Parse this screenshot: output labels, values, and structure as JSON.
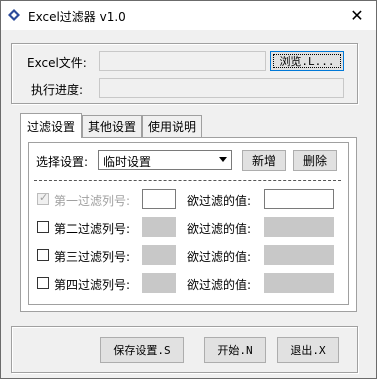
{
  "window": {
    "title": "Excel过滤器 v1.0",
    "close_glyph": "✕"
  },
  "file_section": {
    "excel_file_label": "Excel文件:",
    "excel_file_value": "",
    "browse_label": "浏览.L...",
    "progress_label": "执行进度:",
    "progress_value": ""
  },
  "tabs": [
    {
      "label": "过滤设置",
      "active": true
    },
    {
      "label": "其他设置",
      "active": false
    },
    {
      "label": "使用说明",
      "active": false
    }
  ],
  "filter_settings": {
    "select_label": "选择设置:",
    "select_value": "临时设置",
    "add_label": "新增",
    "delete_label": "删除",
    "rows": [
      {
        "checked": true,
        "enabled": false,
        "column_label": "第一过滤列号:",
        "column_value": "",
        "value_label": "欲过滤的值:",
        "value": ""
      },
      {
        "checked": false,
        "enabled": true,
        "column_label": "第二过滤列号:",
        "column_value": "",
        "value_label": "欲过滤的值:",
        "value": ""
      },
      {
        "checked": false,
        "enabled": true,
        "column_label": "第三过滤列号:",
        "column_value": "",
        "value_label": "欲过滤的值:",
        "value": ""
      },
      {
        "checked": false,
        "enabled": true,
        "column_label": "第四过滤列号:",
        "column_value": "",
        "value_label": "欲过滤的值:",
        "value": ""
      }
    ]
  },
  "footer": {
    "save_label": "保存设置.S",
    "start_label": "开始.N",
    "exit_label": "退出.X"
  }
}
